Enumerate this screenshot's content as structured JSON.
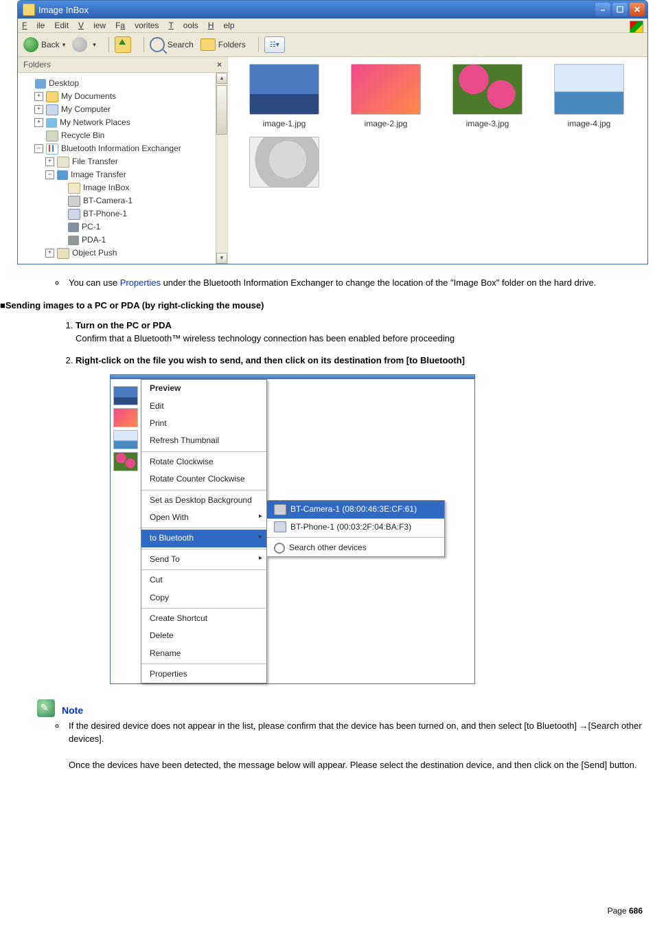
{
  "explorer": {
    "title": "Image InBox",
    "menu": {
      "file": "File",
      "edit": "Edit",
      "view": "View",
      "favorites": "Favorites",
      "tools": "Tools",
      "help": "Help"
    },
    "toolbar": {
      "back": "Back",
      "search": "Search",
      "folders": "Folders"
    },
    "folders_header": "Folders",
    "tree": {
      "desktop": "Desktop",
      "mydocs": "My Documents",
      "mycomp": "My Computer",
      "mynet": "My Network Places",
      "recycle": "Recycle Bin",
      "btexch": "Bluetooth Information Exchanger",
      "filetransfer": "File Transfer",
      "imagetransfer": "Image Transfer",
      "imageinbox": "Image InBox",
      "btcam": "BT-Camera-1",
      "btphone": "BT-Phone-1",
      "pc1": "PC-1",
      "pda1": "PDA-1",
      "objpush": "Object Push"
    },
    "thumbs": [
      "image-1.jpg",
      "image-2.jpg",
      "image-3.jpg",
      "image-4.jpg",
      ""
    ]
  },
  "paragraphs": {
    "p1a": "You can use ",
    "p1link": "Properties",
    "p1b": " under the Bluetooth Information Exchanger to change the location of the \"Image Box\" folder on the hard drive.",
    "section": "■Sending images to a PC or PDA (by right-clicking the mouse)",
    "step1_title": "Turn on the PC or PDA",
    "step1_body": "Confirm that a Bluetooth™ wireless technology connection has been enabled before proceeding",
    "step2_title": "Right-click on the file you wish to send, and then click on its destination from [to Bluetooth]",
    "note_label": "Note",
    "note_body_a": "If the desired device does not appear in the list, please confirm that the device has been turned on, and then select [to Bluetooth] →[Search other devices].",
    "note_body_b": "Once the devices have been detected, the message below will appear. Please select the destination device, and then click on the [Send] button."
  },
  "context_menu": {
    "items": [
      "Preview",
      "Edit",
      "Print",
      "Refresh Thumbnail",
      "Rotate Clockwise",
      "Rotate Counter Clockwise",
      "Set as Desktop Background",
      "Open With",
      "to Bluetooth",
      "Send To",
      "Cut",
      "Copy",
      "Create Shortcut",
      "Delete",
      "Rename",
      "Properties"
    ],
    "flyout": [
      "BT-Camera-1 (08:00:46:3E:CF:61)",
      "BT-Phone-1 (00:03:2F:04:BA:F3)",
      "Search other devices"
    ]
  },
  "footer": {
    "label": "Page",
    "num": "686"
  }
}
